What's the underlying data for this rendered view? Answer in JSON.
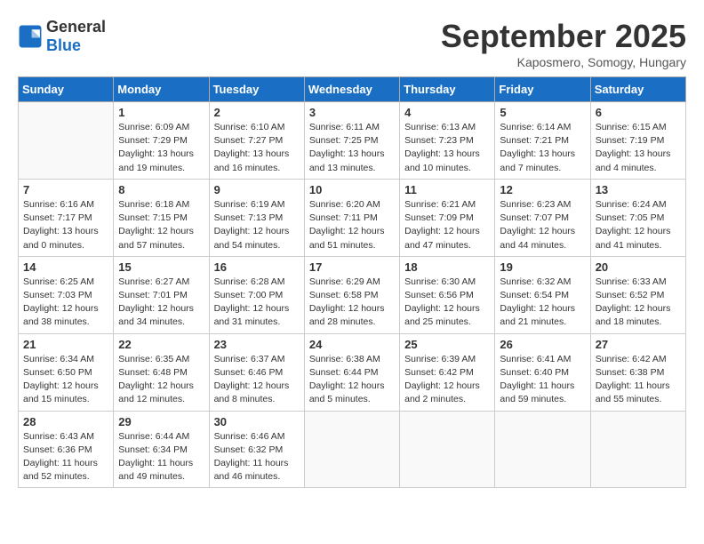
{
  "logo": {
    "general": "General",
    "blue": "Blue"
  },
  "header": {
    "month": "September 2025",
    "location": "Kaposmero, Somogy, Hungary"
  },
  "weekdays": [
    "Sunday",
    "Monday",
    "Tuesday",
    "Wednesday",
    "Thursday",
    "Friday",
    "Saturday"
  ],
  "weeks": [
    [
      {
        "day": "",
        "sunrise": "",
        "sunset": "",
        "daylight": "",
        "empty": true
      },
      {
        "day": "1",
        "sunrise": "Sunrise: 6:09 AM",
        "sunset": "Sunset: 7:29 PM",
        "daylight": "Daylight: 13 hours and 19 minutes."
      },
      {
        "day": "2",
        "sunrise": "Sunrise: 6:10 AM",
        "sunset": "Sunset: 7:27 PM",
        "daylight": "Daylight: 13 hours and 16 minutes."
      },
      {
        "day": "3",
        "sunrise": "Sunrise: 6:11 AM",
        "sunset": "Sunset: 7:25 PM",
        "daylight": "Daylight: 13 hours and 13 minutes."
      },
      {
        "day": "4",
        "sunrise": "Sunrise: 6:13 AM",
        "sunset": "Sunset: 7:23 PM",
        "daylight": "Daylight: 13 hours and 10 minutes."
      },
      {
        "day": "5",
        "sunrise": "Sunrise: 6:14 AM",
        "sunset": "Sunset: 7:21 PM",
        "daylight": "Daylight: 13 hours and 7 minutes."
      },
      {
        "day": "6",
        "sunrise": "Sunrise: 6:15 AM",
        "sunset": "Sunset: 7:19 PM",
        "daylight": "Daylight: 13 hours and 4 minutes."
      }
    ],
    [
      {
        "day": "7",
        "sunrise": "Sunrise: 6:16 AM",
        "sunset": "Sunset: 7:17 PM",
        "daylight": "Daylight: 13 hours and 0 minutes."
      },
      {
        "day": "8",
        "sunrise": "Sunrise: 6:18 AM",
        "sunset": "Sunset: 7:15 PM",
        "daylight": "Daylight: 12 hours and 57 minutes."
      },
      {
        "day": "9",
        "sunrise": "Sunrise: 6:19 AM",
        "sunset": "Sunset: 7:13 PM",
        "daylight": "Daylight: 12 hours and 54 minutes."
      },
      {
        "day": "10",
        "sunrise": "Sunrise: 6:20 AM",
        "sunset": "Sunset: 7:11 PM",
        "daylight": "Daylight: 12 hours and 51 minutes."
      },
      {
        "day": "11",
        "sunrise": "Sunrise: 6:21 AM",
        "sunset": "Sunset: 7:09 PM",
        "daylight": "Daylight: 12 hours and 47 minutes."
      },
      {
        "day": "12",
        "sunrise": "Sunrise: 6:23 AM",
        "sunset": "Sunset: 7:07 PM",
        "daylight": "Daylight: 12 hours and 44 minutes."
      },
      {
        "day": "13",
        "sunrise": "Sunrise: 6:24 AM",
        "sunset": "Sunset: 7:05 PM",
        "daylight": "Daylight: 12 hours and 41 minutes."
      }
    ],
    [
      {
        "day": "14",
        "sunrise": "Sunrise: 6:25 AM",
        "sunset": "Sunset: 7:03 PM",
        "daylight": "Daylight: 12 hours and 38 minutes."
      },
      {
        "day": "15",
        "sunrise": "Sunrise: 6:27 AM",
        "sunset": "Sunset: 7:01 PM",
        "daylight": "Daylight: 12 hours and 34 minutes."
      },
      {
        "day": "16",
        "sunrise": "Sunrise: 6:28 AM",
        "sunset": "Sunset: 7:00 PM",
        "daylight": "Daylight: 12 hours and 31 minutes."
      },
      {
        "day": "17",
        "sunrise": "Sunrise: 6:29 AM",
        "sunset": "Sunset: 6:58 PM",
        "daylight": "Daylight: 12 hours and 28 minutes."
      },
      {
        "day": "18",
        "sunrise": "Sunrise: 6:30 AM",
        "sunset": "Sunset: 6:56 PM",
        "daylight": "Daylight: 12 hours and 25 minutes."
      },
      {
        "day": "19",
        "sunrise": "Sunrise: 6:32 AM",
        "sunset": "Sunset: 6:54 PM",
        "daylight": "Daylight: 12 hours and 21 minutes."
      },
      {
        "day": "20",
        "sunrise": "Sunrise: 6:33 AM",
        "sunset": "Sunset: 6:52 PM",
        "daylight": "Daylight: 12 hours and 18 minutes."
      }
    ],
    [
      {
        "day": "21",
        "sunrise": "Sunrise: 6:34 AM",
        "sunset": "Sunset: 6:50 PM",
        "daylight": "Daylight: 12 hours and 15 minutes."
      },
      {
        "day": "22",
        "sunrise": "Sunrise: 6:35 AM",
        "sunset": "Sunset: 6:48 PM",
        "daylight": "Daylight: 12 hours and 12 minutes."
      },
      {
        "day": "23",
        "sunrise": "Sunrise: 6:37 AM",
        "sunset": "Sunset: 6:46 PM",
        "daylight": "Daylight: 12 hours and 8 minutes."
      },
      {
        "day": "24",
        "sunrise": "Sunrise: 6:38 AM",
        "sunset": "Sunset: 6:44 PM",
        "daylight": "Daylight: 12 hours and 5 minutes."
      },
      {
        "day": "25",
        "sunrise": "Sunrise: 6:39 AM",
        "sunset": "Sunset: 6:42 PM",
        "daylight": "Daylight: 12 hours and 2 minutes."
      },
      {
        "day": "26",
        "sunrise": "Sunrise: 6:41 AM",
        "sunset": "Sunset: 6:40 PM",
        "daylight": "Daylight: 11 hours and 59 minutes."
      },
      {
        "day": "27",
        "sunrise": "Sunrise: 6:42 AM",
        "sunset": "Sunset: 6:38 PM",
        "daylight": "Daylight: 11 hours and 55 minutes."
      }
    ],
    [
      {
        "day": "28",
        "sunrise": "Sunrise: 6:43 AM",
        "sunset": "Sunset: 6:36 PM",
        "daylight": "Daylight: 11 hours and 52 minutes."
      },
      {
        "day": "29",
        "sunrise": "Sunrise: 6:44 AM",
        "sunset": "Sunset: 6:34 PM",
        "daylight": "Daylight: 11 hours and 49 minutes."
      },
      {
        "day": "30",
        "sunrise": "Sunrise: 6:46 AM",
        "sunset": "Sunset: 6:32 PM",
        "daylight": "Daylight: 11 hours and 46 minutes."
      },
      {
        "day": "",
        "sunrise": "",
        "sunset": "",
        "daylight": "",
        "empty": true
      },
      {
        "day": "",
        "sunrise": "",
        "sunset": "",
        "daylight": "",
        "empty": true
      },
      {
        "day": "",
        "sunrise": "",
        "sunset": "",
        "daylight": "",
        "empty": true
      },
      {
        "day": "",
        "sunrise": "",
        "sunset": "",
        "daylight": "",
        "empty": true
      }
    ]
  ]
}
